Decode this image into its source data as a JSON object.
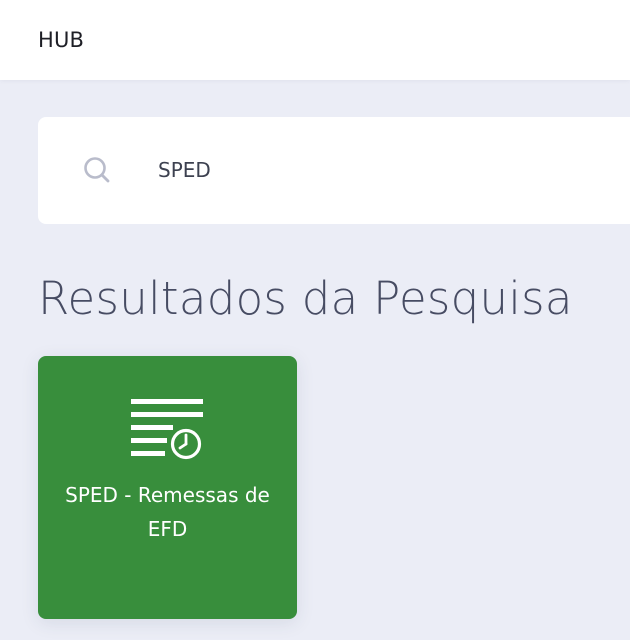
{
  "header": {
    "title": "HUB"
  },
  "search": {
    "value": "SPED",
    "icon": "search-icon"
  },
  "results": {
    "heading": "Resultados da Pesquisa",
    "items": [
      {
        "label": "SPED - Remessas de EFD",
        "icon": "document-clock-icon",
        "color": "#388e3c"
      }
    ]
  },
  "colors": {
    "background": "#ebedf6",
    "surface": "#ffffff",
    "heading_text": "#474c63",
    "card_accent": "#388e3c"
  }
}
